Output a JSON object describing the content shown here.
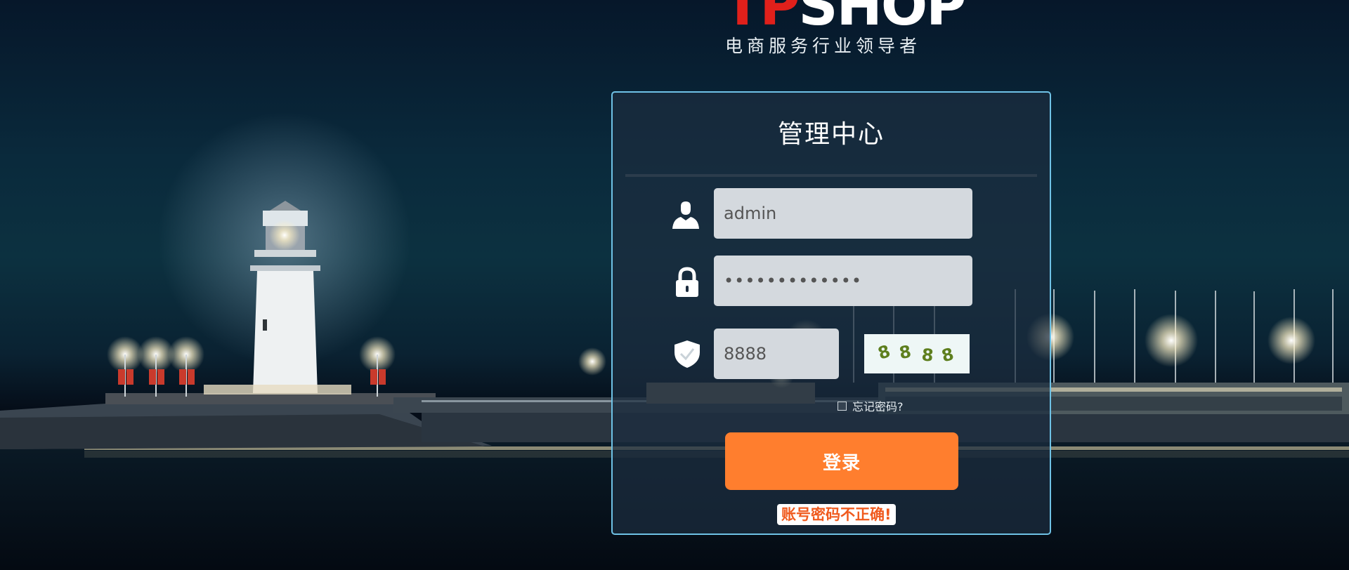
{
  "logo": {
    "brand_red": "TP",
    "brand_white": "SHOP",
    "tagline": "电商服务行业领导者",
    "icon": "tpshop-logo"
  },
  "panel": {
    "title": "管理中心"
  },
  "form": {
    "username": {
      "icon": "user-icon",
      "value": "admin"
    },
    "password": {
      "icon": "lock-icon",
      "value": "•••••••••••••"
    },
    "captcha": {
      "icon": "shield-icon",
      "value": "8888",
      "image_text": "8888"
    },
    "remember_label": "忘记密码?",
    "login_label": "登录",
    "error_message": "账号密码不正确!"
  },
  "colors": {
    "accent_orange": "#ff7e2e",
    "panel_border": "#6fc2e6",
    "error_text": "#f05a1e",
    "brand_red": "#e0201b"
  }
}
